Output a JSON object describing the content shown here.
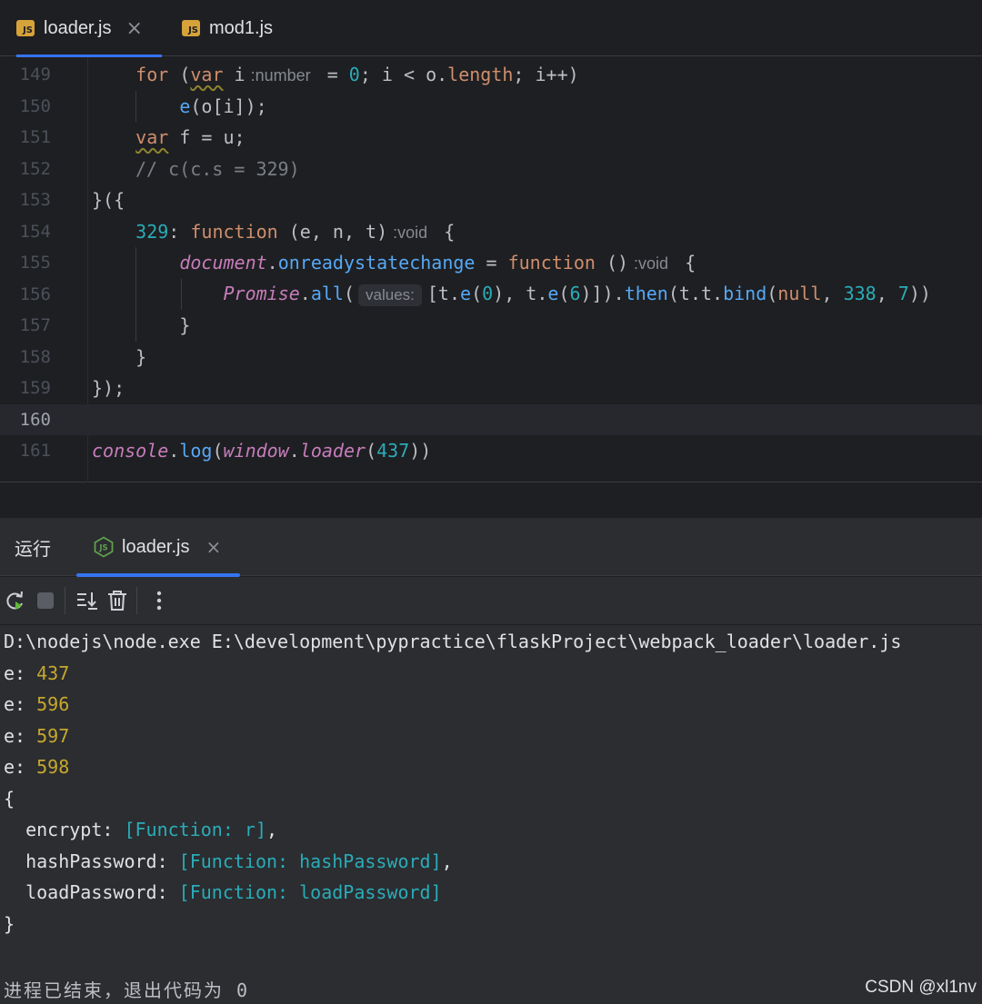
{
  "editor_tabs": [
    {
      "label": "loader.js",
      "badge": "JS",
      "active": true
    },
    {
      "label": "mod1.js",
      "badge": "JS",
      "active": false
    }
  ],
  "editor": {
    "line_numbers": [
      "149",
      "150",
      "151",
      "152",
      "153",
      "154",
      "155",
      "156",
      "157",
      "158",
      "159",
      "160",
      "161"
    ],
    "current_line": "160",
    "hints": {
      "number": ":number",
      "void1": ":void",
      "void2": ":void",
      "values": "values:"
    },
    "comment": "// c(c.s = 329)"
  },
  "run_panel": {
    "title": "运行",
    "tab_label": "loader.js"
  },
  "toolbar": {
    "rerun": "rerun-icon",
    "stop": "stop-icon",
    "scroll": "scroll-to-end-icon",
    "clear": "trash-icon",
    "more": "more-icon"
  },
  "console": {
    "command": "D:\\nodejs\\node.exe E:\\development\\pypractice\\flaskProject\\webpack_loader\\loader.js",
    "e_prefix": "e: ",
    "e_values": [
      "437",
      "596",
      "597",
      "598"
    ],
    "open_brace": "{",
    "close_brace": "}",
    "props": [
      {
        "key": "  encrypt: ",
        "value": "[Function: r]",
        "suffix": ","
      },
      {
        "key": "  hashPassword: ",
        "value": "[Function: hashPassword]",
        "suffix": ","
      },
      {
        "key": "  loadPassword: ",
        "value": "[Function: loadPassword]",
        "suffix": ""
      }
    ],
    "exit_message": "进程已结束，退出代码为 0"
  },
  "watermark": "CSDN @xl1nv"
}
